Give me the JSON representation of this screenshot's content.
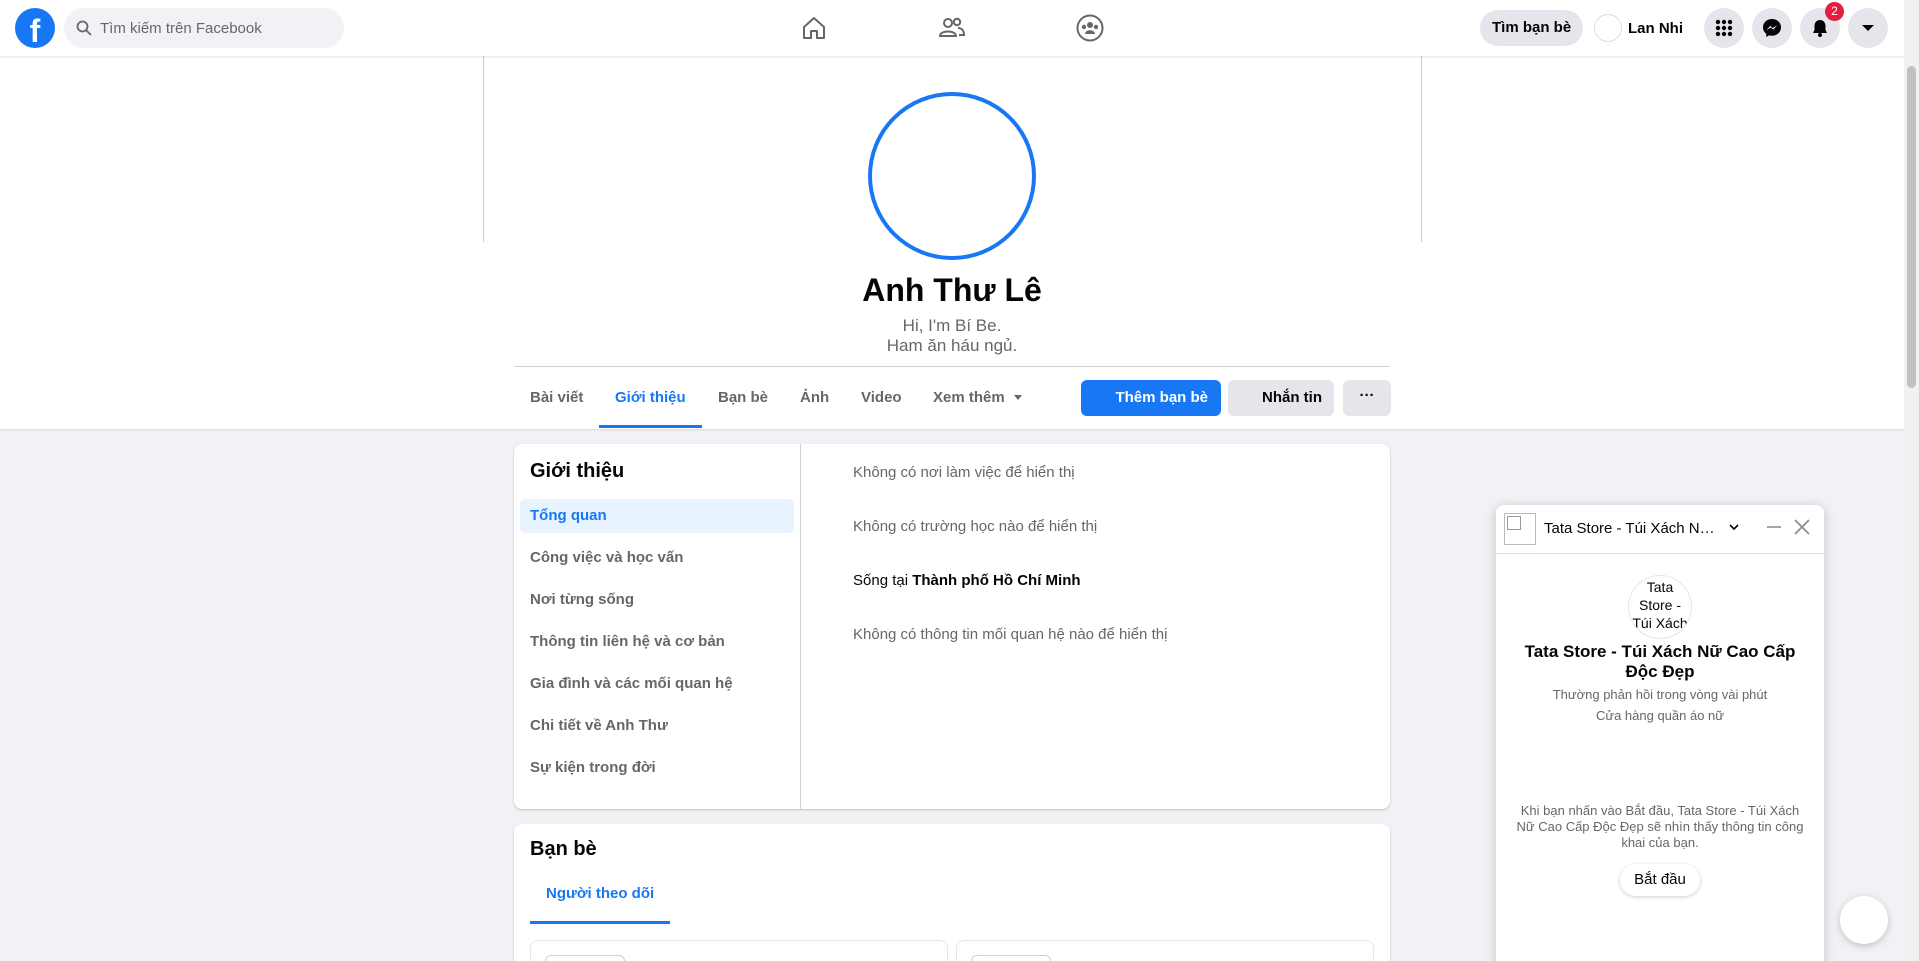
{
  "colors": {
    "accent": "#1877f2",
    "notification_badge": "#e41e3f",
    "background": "#f0f2f5"
  },
  "topbar": {
    "logo": "f",
    "search_placeholder": "Tìm kiếm trên Facebook",
    "nav_icons": [
      "home-icon",
      "friends-icon",
      "groups-icon"
    ],
    "find_friends_label": "Tìm bạn bè",
    "user_name": "Lan Nhi",
    "menu_icon": "menu-grid-icon",
    "messenger_icon": "messenger-icon",
    "notifications_icon": "bell-icon",
    "notifications_count": "2",
    "account_icon": "caret-down-icon"
  },
  "profile": {
    "name": "Anh Thư Lê",
    "bio_line1": "Hi, I'm Bí Be.",
    "bio_line2": "Ham ăn háu ngủ.",
    "tabs": [
      {
        "label": "Bài viết",
        "active": false
      },
      {
        "label": "Giới thiệu",
        "active": true
      },
      {
        "label": "Bạn bè",
        "active": false
      },
      {
        "label": "Ảnh",
        "active": false
      },
      {
        "label": "Video",
        "active": false
      },
      {
        "label": "Xem thêm",
        "active": false
      }
    ],
    "add_friend_label": "Thêm bạn bè",
    "message_label": "Nhắn tin",
    "more_label": "···"
  },
  "about": {
    "title": "Giới thiệu",
    "menu": [
      {
        "label": "Tổng quan",
        "active": true
      },
      {
        "label": "Công việc và học vấn",
        "active": false
      },
      {
        "label": "Nơi từng sống",
        "active": false
      },
      {
        "label": "Thông tin liên hệ và cơ bản",
        "active": false
      },
      {
        "label": "Gia đình và các mối quan hệ",
        "active": false
      },
      {
        "label": "Chi tiết về Anh Thư",
        "active": false
      },
      {
        "label": "Sự kiện trong đời",
        "active": false
      }
    ],
    "workplace": "Không có nơi làm việc để hiển thị",
    "school": "Không có trường học nào để hiển thị",
    "lives_prefix": "Sống tại ",
    "lives_city": "Thành phố Hồ Chí Minh",
    "relationship": "Không có thông tin mối quan hệ nào để hiển thị"
  },
  "friends": {
    "title": "Bạn bè",
    "tab_label": "Người theo dõi"
  },
  "chat": {
    "header_title": "Tata Store - Túi Xách Nữ Cao Cấp Độc Đẹp",
    "avatar_alt": "Tata Store - Túi Xách",
    "page_name": "Tata Store - Túi Xách Nữ Cao Cấp Độc Đẹp",
    "response_time": "Thường phản hồi trong vòng vài phút",
    "category": "Cửa hàng quần áo nữ",
    "consent": "Khi bạn nhấn vào Bắt đầu, Tata Store - Túi Xách Nữ Cao Cấp Độc Đẹp sẽ nhìn thấy thông tin công khai của bạn.",
    "start_label": "Bắt đầu"
  }
}
